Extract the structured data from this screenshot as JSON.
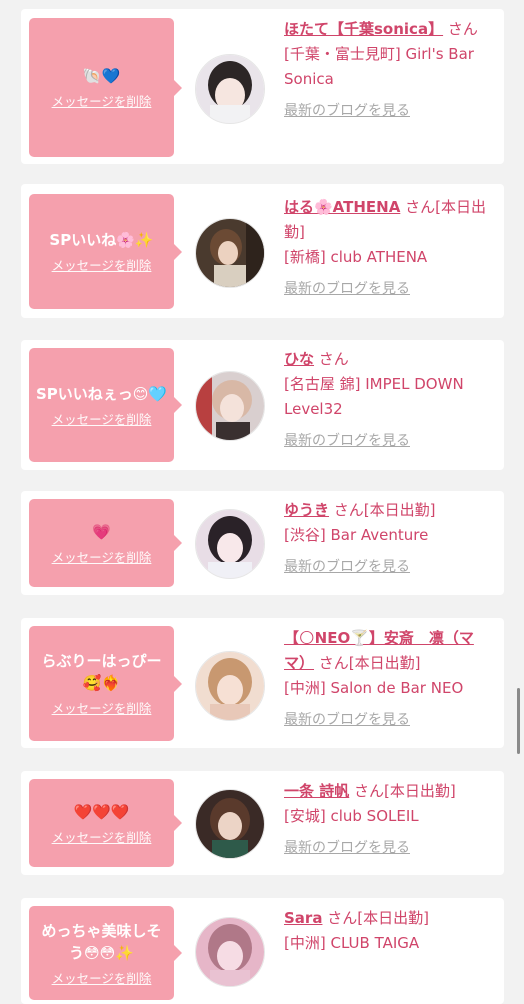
{
  "labels": {
    "delete": "メッセージを削除",
    "blog": "最新のブログを見る",
    "san": "さん"
  },
  "colors": {
    "background": "#f2f2f2",
    "card": "#ffffff",
    "bubble": "#f5a0ad",
    "accent": "#d0456a",
    "link_gray": "#a8a8a8"
  },
  "cards": [
    {
      "message": "🐚💙",
      "name": "ほたて【千葉sonica】",
      "suffix": "さん",
      "shop": "[千葉・富士見町] Girl's Bar Sonica"
    },
    {
      "message": "SPいいね🌸✨",
      "name": "はる🌸ATHENA",
      "suffix": "さん[本日出勤]",
      "shop": "[新橋] club ATHENA"
    },
    {
      "message": "SPいいねぇっ😊🩵",
      "name": "ひな",
      "suffix": "さん",
      "shop": "[名古屋 錦] IMPEL DOWN Level32"
    },
    {
      "message": "💗",
      "name": "ゆうき",
      "suffix": "さん[本日出勤]",
      "shop": "[渋谷] Bar Aventure"
    },
    {
      "message": "らぶりーはっぴー🥰❤️‍🔥",
      "name": "【🌕NEO🍸】安斎　凛（ママ）",
      "suffix": "さん[本日出勤]",
      "shop": "[中洲] Salon de Bar NEO"
    },
    {
      "message": "❤️❤️❤️",
      "name": "一条 詩帆",
      "suffix": "さん[本日出勤]",
      "shop": "[安城] club SOLEIL"
    },
    {
      "message": "めっちゃ美味しそう😳😳✨",
      "name": "Sara",
      "suffix": "さん[本日出勤]",
      "shop": "[中洲] CLUB TAIGA"
    }
  ]
}
